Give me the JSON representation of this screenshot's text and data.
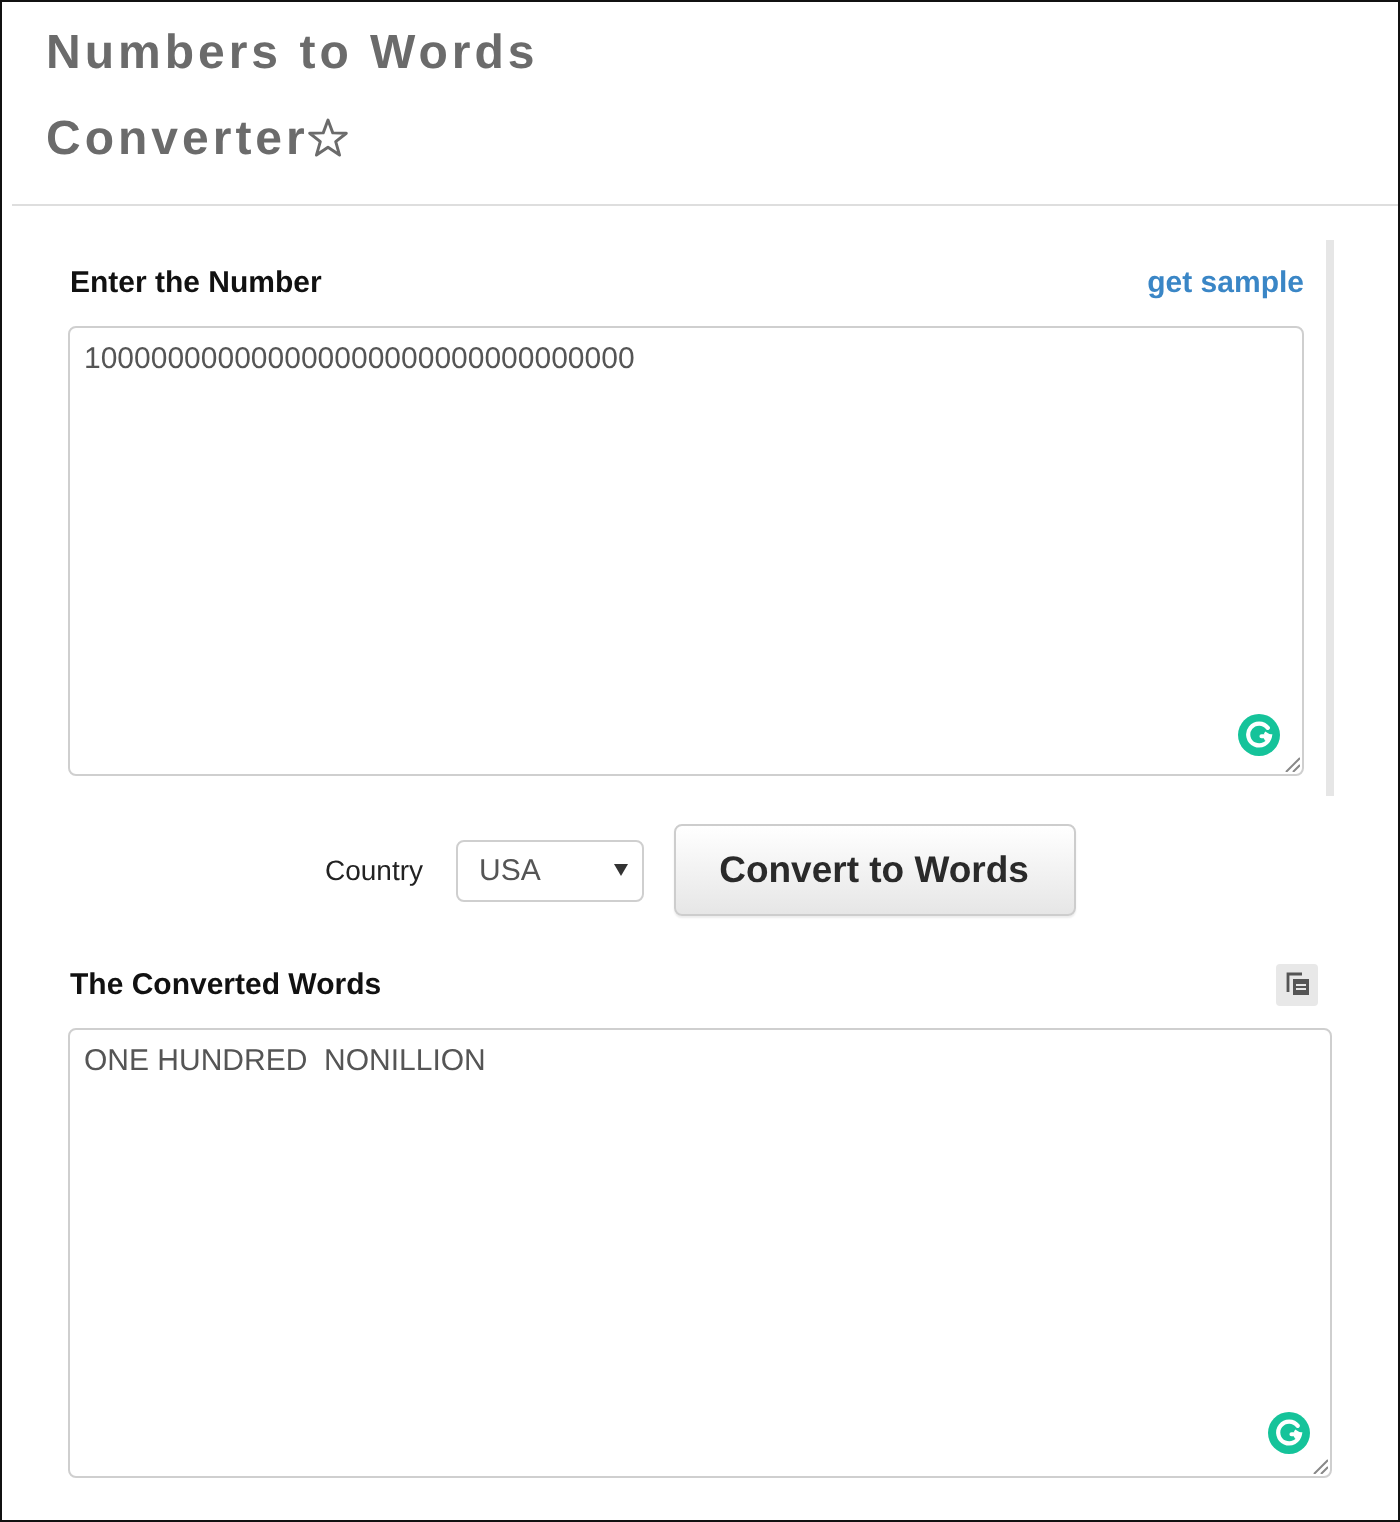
{
  "title": {
    "lines": [
      "Numbers to Words",
      "Converter"
    ],
    "starred": false
  },
  "input_section": {
    "label": "Enter the Number",
    "sample_link": "get sample",
    "value": "100000000000000000000000000000000"
  },
  "controls": {
    "country_label": "Country",
    "country_select": "USA",
    "convert_button": "Convert to Words"
  },
  "output_section": {
    "label": "The Converted Words",
    "value": "ONE HUNDRED  NONILLION"
  }
}
